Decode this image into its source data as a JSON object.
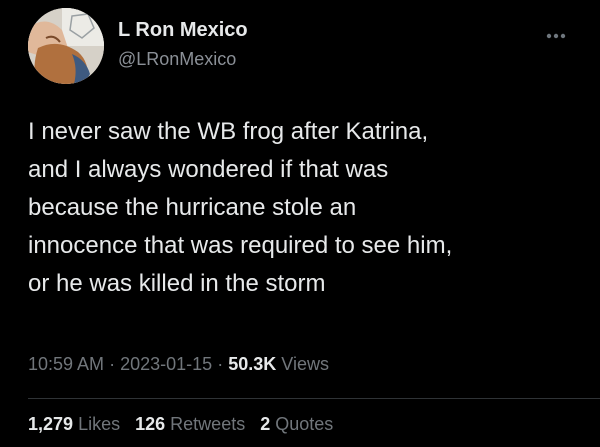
{
  "author": {
    "display_name": "L Ron Mexico",
    "handle": "@LRonMexico",
    "avatar_icon": "profile-photo"
  },
  "more_icon": "more-horizontal-icon",
  "tweet": {
    "text": "I never saw the WB frog after Katrina,\nand I always wondered if that was\nbecause the hurricane stole an\ninnocence that was required to see him,\nor he was killed in the storm",
    "time": "10:59 AM",
    "separator": "·",
    "date": "2023-01-15",
    "views_count": "50.3K",
    "views_label": "Views"
  },
  "stats": {
    "likes_count": "1,279",
    "likes_label": "Likes",
    "retweets_count": "126",
    "retweets_label": "Retweets",
    "quotes_count": "2",
    "quotes_label": "Quotes"
  },
  "colors": {
    "background": "#000000",
    "primary_text": "#e7e9ea",
    "secondary_text": "#71767b",
    "divider": "#2f3336"
  }
}
